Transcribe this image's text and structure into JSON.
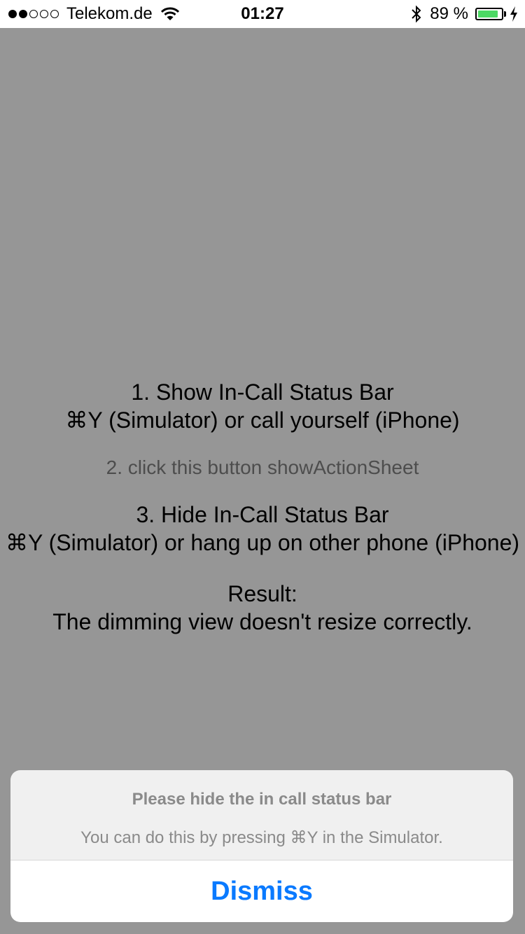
{
  "status_bar": {
    "signal_dots": [
      "filled",
      "filled",
      "empty",
      "empty",
      "empty"
    ],
    "carrier": "Telekom.de",
    "time": "01:27",
    "battery_percent": "89 %",
    "battery_level": 0.89,
    "battery_color": "#4cd964",
    "icons": [
      "wifi-icon",
      "bluetooth-icon",
      "battery-icon",
      "charging-bolt-icon"
    ]
  },
  "instructions": {
    "step1_title": "1. Show In-Call Status Bar",
    "step1_detail": "⌘Y (Simulator) or call yourself (iPhone)",
    "step2_button": "2. click this button showActionSheet",
    "step3_title": "3. Hide In-Call Status Bar",
    "step3_detail": "⌘Y (Simulator) or hang up on other phone (iPhone)",
    "result_label": "Result:",
    "result_text": "The dimming view doesn't resize correctly."
  },
  "action_sheet": {
    "title": "Please hide the in call status bar",
    "message": "You can do this by pressing ⌘Y in the Simulator.",
    "dismiss_label": "Dismiss",
    "accent_color": "#0a7aff"
  },
  "colors": {
    "dimming_overlay": "#969696"
  }
}
